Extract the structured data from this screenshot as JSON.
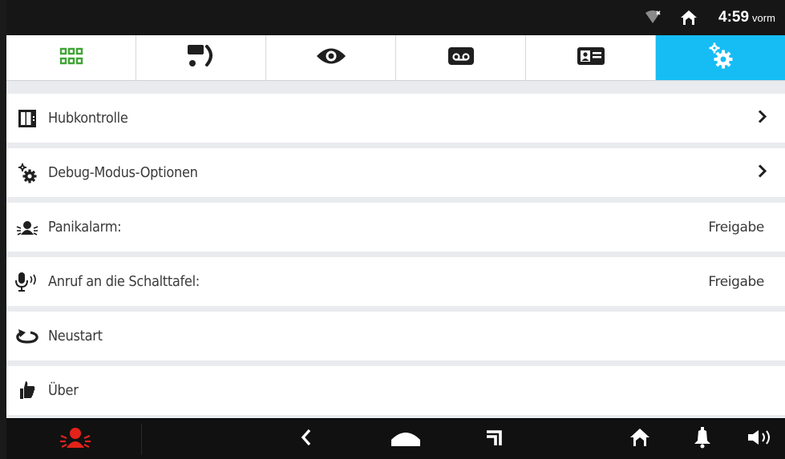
{
  "status_bar": {
    "time": "4:59",
    "time_suffix": "vorm",
    "icons": [
      "wifi-off-icon",
      "home-status-icon"
    ]
  },
  "tabs": [
    {
      "name": "apps",
      "icon": "grid-icon",
      "active": false,
      "color": "#3fa535"
    },
    {
      "name": "intercom",
      "icon": "intercom-call-icon",
      "active": false
    },
    {
      "name": "camera",
      "icon": "eye-icon",
      "active": false
    },
    {
      "name": "messages",
      "icon": "voicemail-icon",
      "active": false
    },
    {
      "name": "contacts",
      "icon": "contact-card-icon",
      "active": false
    },
    {
      "name": "settings",
      "icon": "settings-gears-icon",
      "active": true,
      "color": "#16bdf5"
    }
  ],
  "menu": {
    "items": [
      {
        "label": "Hubkontrolle",
        "icon": "elevator-icon",
        "value": "",
        "chevron": true
      },
      {
        "label": "Debug-Modus-Optionen",
        "icon": "gears-icon",
        "value": "",
        "chevron": true
      },
      {
        "label": "Panikalarm:",
        "icon": "panic-alarm-icon",
        "value": "Freigabe",
        "chevron": false
      },
      {
        "label": "Anruf an die Schalttafel:",
        "icon": "microphone-icon",
        "value": "Freigabe",
        "chevron": false
      },
      {
        "label": "Neustart",
        "icon": "restart-icon",
        "value": "",
        "chevron": false
      },
      {
        "label": "Über",
        "icon": "thumbs-up-icon",
        "value": "",
        "chevron": false
      }
    ]
  },
  "nav_bar": {
    "items": [
      "panic-button-icon",
      "back-icon",
      "home-icon",
      "recent-apps-icon",
      "home-status-icon",
      "bell-icon",
      "volume-icon"
    ],
    "accent": "#e32219"
  }
}
